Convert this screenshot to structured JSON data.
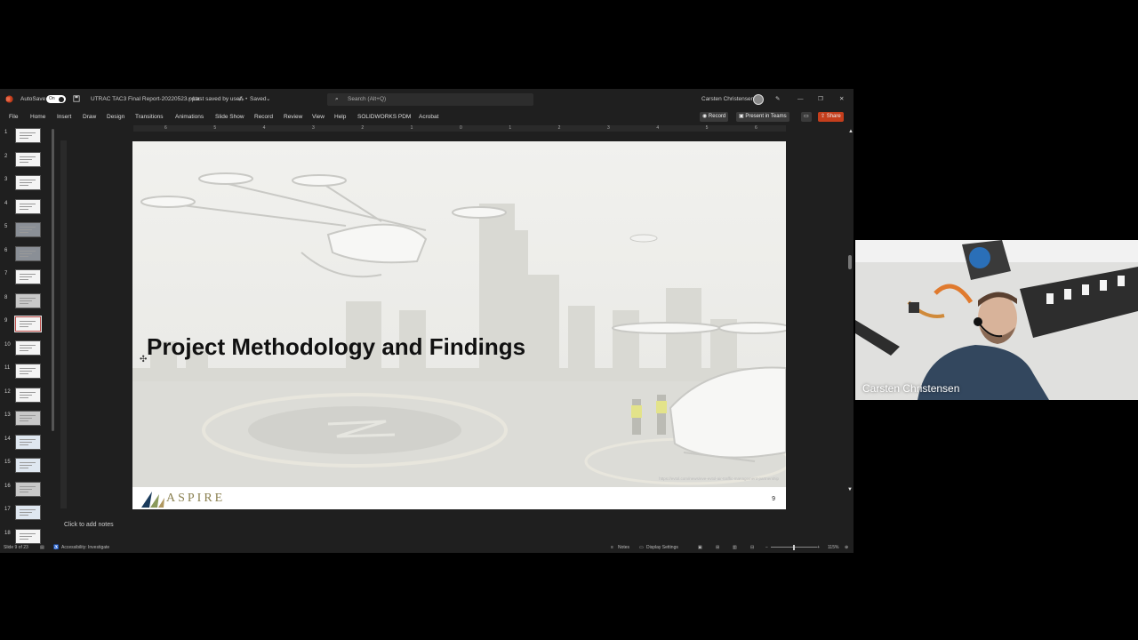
{
  "titlebar": {
    "autosave_label": "AutoSave",
    "autosave_state": "On",
    "file_name": "UTRAC TAC3 Final Report-20220523.pptx",
    "save_status": "Last saved by user",
    "saved_label": "Saved",
    "search_placeholder": "Search (Alt+Q)",
    "user_name": "Carsten Christensen"
  },
  "menu": {
    "items": [
      "File",
      "Home",
      "Insert",
      "Draw",
      "Design",
      "Transitions",
      "Animations",
      "Slide Show",
      "Record",
      "Review",
      "View",
      "Help",
      "SOLIDWORKS PDM",
      "Acrobat"
    ],
    "record_button": "Record",
    "present_button": "Present in Teams",
    "share_button": "Share"
  },
  "ruler": {
    "ticks": [
      "6",
      "5",
      "4",
      "3",
      "2",
      "1",
      "0",
      "1",
      "2",
      "3",
      "4",
      "5",
      "6"
    ]
  },
  "thumbnails": [
    "1",
    "2",
    "3",
    "4",
    "5",
    "6",
    "7",
    "8",
    "9",
    "10",
    "11",
    "12",
    "13",
    "14",
    "15",
    "16",
    "17",
    "18"
  ],
  "slide": {
    "title": "Project Methodology and Findings",
    "logo_text": "ASPIRE",
    "page_number": "9",
    "source_url": "https://evtol.com/news/eve-evtol-air-traffic-management-partnership"
  },
  "notes": {
    "placeholder": "Click to add notes"
  },
  "status": {
    "slide_info": "Slide 9 of 23",
    "accessibility": "Accessibility: Investigate",
    "notes_label": "Notes",
    "display_settings": "Display Settings",
    "zoom": "115%"
  },
  "video": {
    "participant_name": "Carsten Christensen"
  },
  "colors": {
    "share": "#c43e1c",
    "window_bg": "#1f1f1f",
    "slide_bg": "#ececec"
  }
}
